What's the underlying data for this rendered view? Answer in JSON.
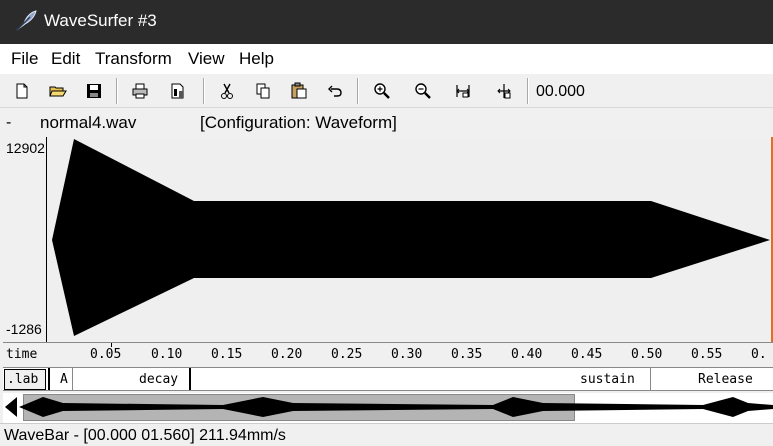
{
  "window": {
    "title": "WaveSurfer #3",
    "icon": "feather-icon"
  },
  "menubar": {
    "items": [
      "File",
      "Edit",
      "Transform",
      "View",
      "Help"
    ]
  },
  "toolbar": {
    "buttons": [
      "new-file-icon",
      "open-folder-icon",
      "save-icon",
      "print-icon",
      "properties-icon",
      "cut-icon",
      "copy-icon",
      "paste-icon",
      "undo-icon",
      "zoom-in-icon",
      "zoom-out-icon",
      "zoom-fit-icon",
      "zoom-selection-icon"
    ],
    "time": "00.000"
  },
  "file_info": {
    "dash": "-",
    "filename": "normal4.wav",
    "configuration": "[Configuration: Waveform]"
  },
  "waveform": {
    "y_max": "12902",
    "y_min": "-1286",
    "fill_color": "#000000",
    "background": "#efefef",
    "cursor_color": "#e07020"
  },
  "timebar": {
    "label": "time",
    "ticks": [
      "0.05",
      "0.10",
      "0.15",
      "0.20",
      "0.25",
      "0.30",
      "0.35",
      "0.40",
      "0.45",
      "0.50",
      "0.55",
      "0."
    ]
  },
  "labelbar": {
    "button": ".lab",
    "segments": [
      "A",
      "decay",
      "sustain",
      "Release"
    ]
  },
  "statusbar": {
    "text": "WaveBar - [00.000 01.560] 211.94mm/s"
  }
}
